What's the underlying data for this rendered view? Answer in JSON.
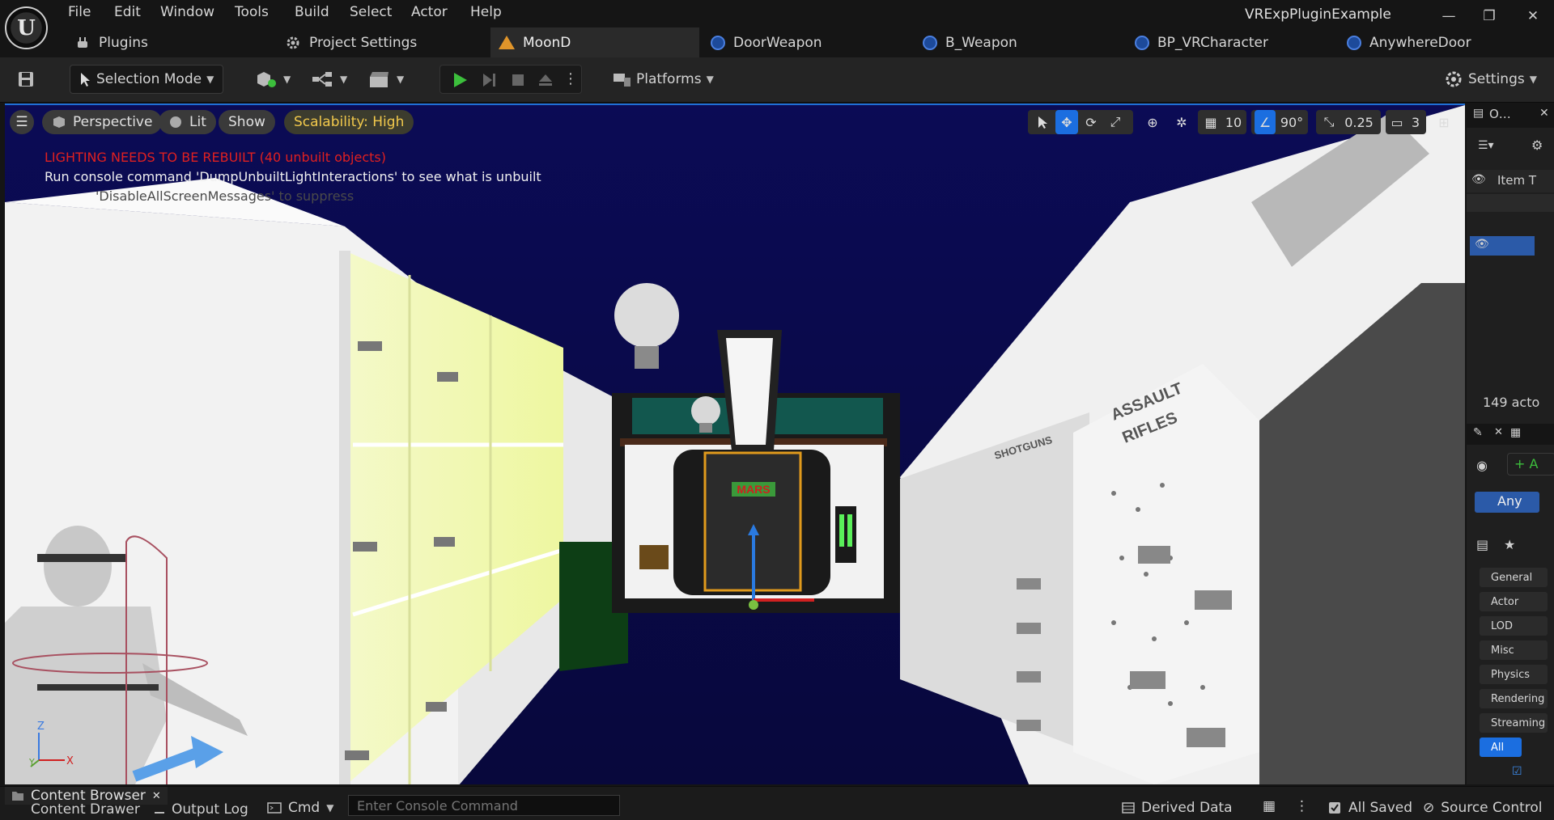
{
  "app": {
    "logo_letter": "U",
    "project_name": "VRExpPluginExample",
    "window_controls": {
      "minimize": "—",
      "restore": "❐",
      "close": "✕"
    }
  },
  "menu": [
    "File",
    "Edit",
    "Window",
    "Tools",
    "Build",
    "Select",
    "Actor",
    "Help"
  ],
  "tabs": [
    {
      "label": "Plugins",
      "icon": "plug-icon"
    },
    {
      "label": "Project Settings",
      "icon": "gear-icon"
    },
    {
      "label": "MoonD",
      "icon": "level-icon",
      "active": true
    },
    {
      "label": "DoorWeapon",
      "icon": "blueprint-icon"
    },
    {
      "label": "B_Weapon",
      "icon": "blueprint-icon"
    },
    {
      "label": "BP_VRCharacter",
      "icon": "blueprint-icon"
    },
    {
      "label": "AnywhereDoor",
      "icon": "blueprint-icon"
    }
  ],
  "toolbar": {
    "selection_mode": "Selection Mode",
    "platforms": "Platforms",
    "settings": "Settings"
  },
  "viewport": {
    "perspective": "Perspective",
    "lit": "Lit",
    "show": "Show",
    "scalability": "Scalability: High",
    "grid_size": "10",
    "rotation_snap": "90°",
    "scale_snap": "0.25",
    "camera_speed": "3",
    "messages": {
      "lighting": "LIGHTING NEEDS TO BE REBUILT (40 unbuilt objects)",
      "console": "Run console command 'DumpUnbuiltLightInteractions' to see what is unbuilt",
      "disable": "'DisableAllScreenMessages' to suppress"
    },
    "scene_signs": {
      "door": "MARS",
      "rack_1": "ASSAULT",
      "rack_2": "RIFLES",
      "rack_3": "SHOTGUNS"
    },
    "axis": {
      "z": "Z",
      "x": "X",
      "y": "Y"
    }
  },
  "outliner": {
    "title": "O…",
    "column": "Item T",
    "count": "149 acto"
  },
  "details": {
    "add_label": "+ A",
    "component": "Any",
    "categories": [
      "General",
      "Actor",
      "LOD",
      "Misc",
      "Physics",
      "Rendering",
      "Streaming",
      "All"
    ],
    "selected_category": "All"
  },
  "statusbar": {
    "content_browser": "Content Browser",
    "content_drawer": "Content Drawer",
    "output_log": "Output Log",
    "cmd": "Cmd",
    "console_placeholder": "Enter Console Command",
    "derived_data": "Derived Data",
    "all_saved": "All Saved",
    "source_control": "Source Control"
  },
  "colors": {
    "accent": "#1b6ee0",
    "error_text": "#e02020",
    "scalability_text": "#f2c94c",
    "play_green": "#3cbf3c",
    "sky": "#08084a"
  }
}
